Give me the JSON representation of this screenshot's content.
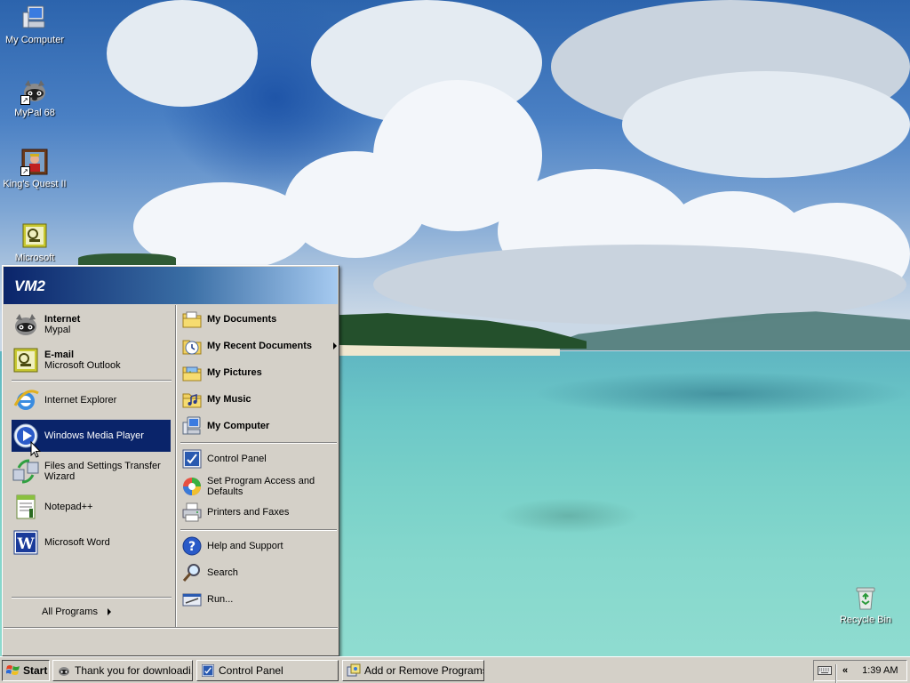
{
  "desktop": {
    "icons": [
      {
        "label": "My Computer",
        "icon": "my-computer-icon"
      },
      {
        "label": "MyPal 68",
        "icon": "raccoon-icon",
        "shortcut": "↗"
      },
      {
        "label": "King's Quest II",
        "icon": "kings-quest-icon",
        "shortcut": "↗"
      },
      {
        "label": "Microsoft",
        "icon": "outlook-icon"
      },
      {
        "label": "Recycle Bin",
        "icon": "recycle-bin-icon"
      }
    ]
  },
  "start_menu": {
    "user_name": "VM2",
    "left": {
      "pinned": [
        {
          "title": "Internet",
          "subtitle": "Mypal",
          "icon": "raccoon-icon"
        },
        {
          "title": "E-mail",
          "subtitle": "Microsoft Outlook",
          "icon": "outlook-icon"
        }
      ],
      "recent": [
        {
          "label": "Internet Explorer",
          "icon": "internet-explorer-icon"
        },
        {
          "label": "Windows Media Player",
          "icon": "media-player-icon"
        },
        {
          "label": "Files and Settings Transfer Wizard",
          "label_line1": "Files and Settings Transfer",
          "label_line2": "Wizard",
          "icon": "transfer-wizard-icon"
        },
        {
          "label": "Notepad++",
          "icon": "notepad-plus-icon"
        },
        {
          "label": "Microsoft Word",
          "icon": "word-icon"
        }
      ],
      "all_programs": "All Programs"
    },
    "right": {
      "places": [
        {
          "label": "My Documents",
          "icon": "folder-documents-icon"
        },
        {
          "label": "My Recent Documents",
          "icon": "recent-documents-icon"
        },
        {
          "label": "My Pictures",
          "icon": "folder-pictures-icon"
        },
        {
          "label": "My Music",
          "icon": "folder-music-icon"
        },
        {
          "label": "My Computer",
          "icon": "my-computer-icon"
        }
      ],
      "settings": [
        {
          "label": "Control Panel",
          "icon": "control-panel-icon"
        },
        {
          "label": "Set Program Access and Defaults",
          "label_line1": "Set Program Access and",
          "label_line2": "Defaults",
          "icon": "program-access-icon"
        },
        {
          "label": "Printers and Faxes",
          "icon": "printer-icon"
        }
      ],
      "help": [
        {
          "label": "Help and Support",
          "icon": "help-icon"
        },
        {
          "label": "Search",
          "icon": "search-icon"
        },
        {
          "label": "Run...",
          "icon": "run-icon"
        }
      ]
    }
  },
  "taskbar": {
    "start_label": "Start",
    "tasks": [
      {
        "label": "Thank you for downloadi...",
        "icon": "raccoon-icon"
      },
      {
        "label": "Control Panel",
        "icon": "control-panel-icon"
      },
      {
        "label": "Add or Remove Programs",
        "icon": "add-remove-programs-icon"
      }
    ],
    "tray_expand": "«",
    "clock": "1:39 AM"
  }
}
